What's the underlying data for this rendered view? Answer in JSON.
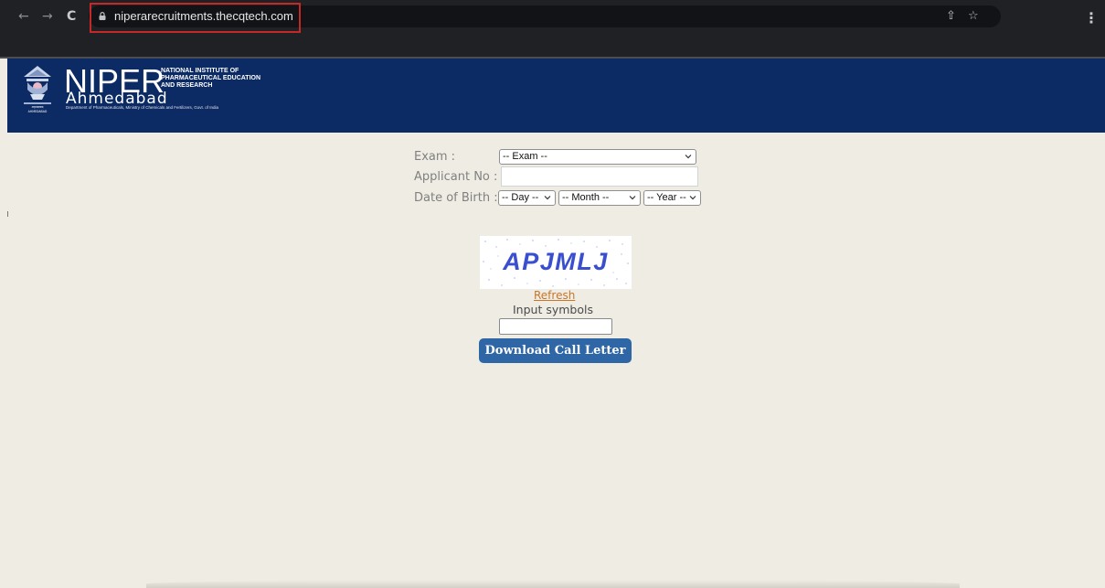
{
  "browser": {
    "url": "niperarecruitments.thecqtech.com",
    "back_glyph": "←",
    "forward_glyph": "→",
    "reload_glyph": "C",
    "share_glyph": "⇧",
    "bookmark_glyph": "☆",
    "menu_glyph": "⋮"
  },
  "header": {
    "logo_title": "NIPER",
    "logo_city": "Ahmedabad",
    "logo_full_name": [
      "NATIONAL INSTITUTE OF",
      "PHARMACEUTICAL EDUCATION",
      "AND RESEARCH"
    ],
    "logo_department": "Department of Pharmaceuticals, Ministry of Chemicals and Fertilizers, Govt. of India",
    "emblem_text": "अहमदाबाद AHMEDABAD",
    "background_color": "#0c2a63"
  },
  "form": {
    "exam_label": "Exam :",
    "exam_selected": "-- Exam --",
    "applicant_label": "Applicant No :",
    "applicant_value": "",
    "dob_label": "Date of Birth :",
    "day_selected": "-- Day --",
    "month_selected": "-- Month --",
    "year_selected": "-- Year --"
  },
  "captcha": {
    "text": "APJMLJ",
    "refresh_label": "Refresh",
    "input_label": "Input symbols",
    "input_value": ""
  },
  "actions": {
    "download_label": "Download Call Letter",
    "download_color": "#2f66a5"
  }
}
